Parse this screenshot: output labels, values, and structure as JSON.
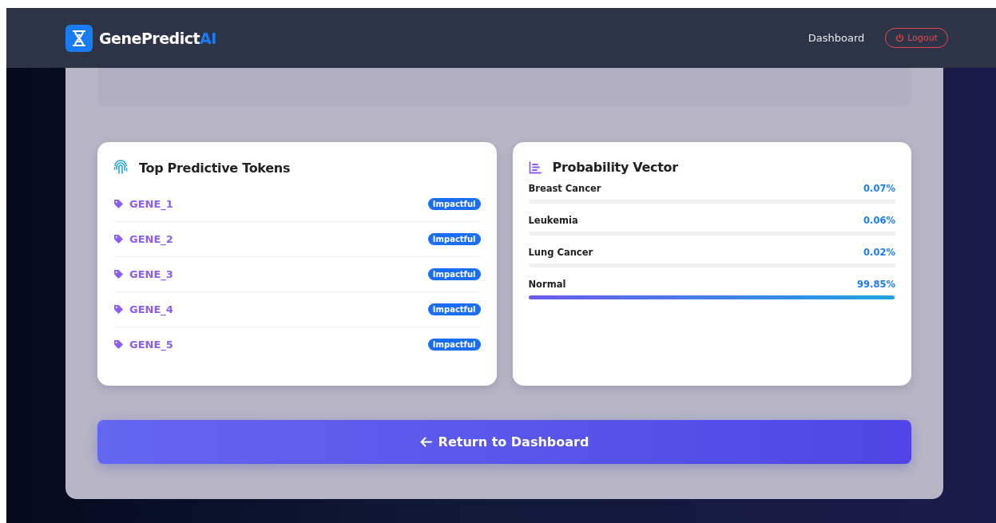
{
  "header": {
    "brand": "GenePredict",
    "brand_accent": "AI",
    "nav": [
      {
        "label": "Dashboard",
        "kind": "link"
      },
      {
        "label": "Logout",
        "kind": "logout"
      }
    ]
  },
  "tokens_card": {
    "title": "Top Predictive Tokens",
    "items": [
      {
        "token": "GENE_1",
        "badge": "Impactful"
      },
      {
        "token": "GENE_2",
        "badge": "Impactful"
      },
      {
        "token": "GENE_3",
        "badge": "Impactful"
      },
      {
        "token": "GENE_4",
        "badge": "Impactful"
      },
      {
        "token": "GENE_5",
        "badge": "Impactful"
      }
    ]
  },
  "probability_card": {
    "title": "Probability Vector",
    "classes": [
      {
        "name": "Breast Cancer",
        "reading": "0.07%",
        "level": 0.0007
      },
      {
        "name": "Leukemia",
        "reading": "0.06%",
        "level": 0.0006
      },
      {
        "name": "Lung Cancer",
        "reading": "0.02%",
        "level": 0.0002
      },
      {
        "name": "Normal",
        "reading": "99.85%",
        "level": 0.9985
      }
    ]
  },
  "return_button": {
    "label": "Return to Dashboard"
  }
}
